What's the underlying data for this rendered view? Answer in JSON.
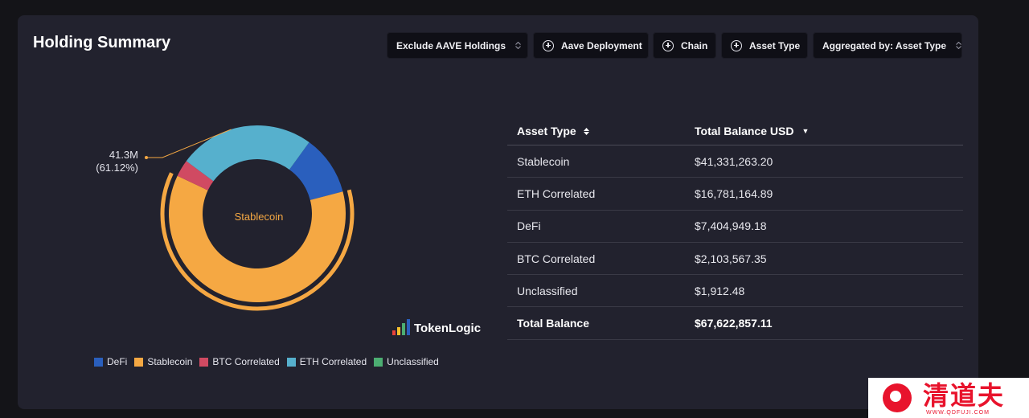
{
  "header": {
    "title": "Holding Summary",
    "buttons": {
      "exclude": "Exclude AAVE Holdings",
      "deployment": "Aave Deployment",
      "chain": "Chain",
      "asset_type": "Asset Type",
      "aggregated": "Aggregated by: Asset Type"
    }
  },
  "donut": {
    "callout_value": "41.3M",
    "callout_pct": "(61.12%)",
    "center_label": "Stablecoin",
    "highlighted": "Stablecoin"
  },
  "chart_data": {
    "type": "pie",
    "categories": [
      "DeFi",
      "Stablecoin",
      "BTC Correlated",
      "ETH Correlated",
      "Unclassified"
    ],
    "values": [
      7404949.18,
      41331263.2,
      2103567.35,
      16781164.89,
      1912.48
    ],
    "colors": [
      "#2a5fbd",
      "#f5a843",
      "#d04a62",
      "#56b0cd",
      "#4cae72"
    ]
  },
  "legend": {
    "items": [
      {
        "label": "DeFi",
        "color": "#2a5fbd"
      },
      {
        "label": "Stablecoin",
        "color": "#f5a843"
      },
      {
        "label": "BTC Correlated",
        "color": "#d04a62"
      },
      {
        "label": "ETH Correlated",
        "color": "#56b0cd"
      },
      {
        "label": "Unclassified",
        "color": "#4cae72"
      }
    ]
  },
  "logo": {
    "name": "TokenLogic",
    "bar_colors": [
      "#e8413a",
      "#f5c02e",
      "#4cae72",
      "#2a5fbd"
    ]
  },
  "table": {
    "col1": "Asset Type",
    "col2": "Total Balance USD",
    "rows": [
      {
        "asset": "Stablecoin",
        "balance": "$41,331,263.20"
      },
      {
        "asset": "ETH Correlated",
        "balance": "$16,781,164.89"
      },
      {
        "asset": "DeFi",
        "balance": "$7,404,949.18"
      },
      {
        "asset": "BTC Correlated",
        "balance": "$2,103,567.35"
      },
      {
        "asset": "Unclassified",
        "balance": "$1,912.48"
      }
    ],
    "total_label": "Total Balance",
    "total_value": "$67,622,857.11"
  },
  "watermark": {
    "brand": "清道夫",
    "url": "WWW.QDFUJI.COM"
  }
}
